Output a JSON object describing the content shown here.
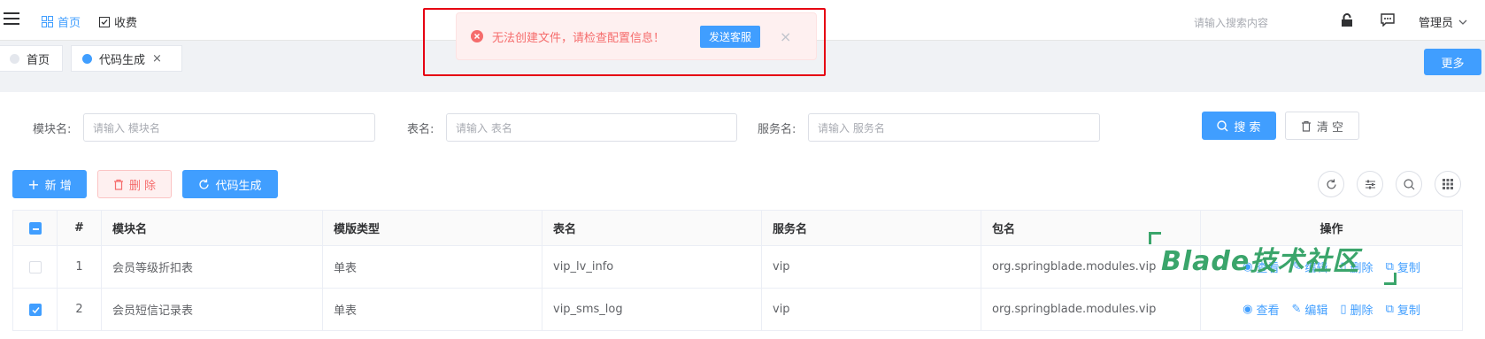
{
  "topbar": {
    "nav": [
      {
        "label": "首页",
        "icon": "grid-icon"
      },
      {
        "label": "收费",
        "icon": "checkbox-icon"
      }
    ],
    "search_placeholder": "请输入搜索内容",
    "user": "管理员"
  },
  "tags": [
    {
      "label": "首页"
    },
    {
      "label": "代码生成"
    }
  ],
  "more_label": "更多",
  "filters": [
    {
      "label": "模块名:",
      "placeholder": "请输入 模块名"
    },
    {
      "label": "表名:",
      "placeholder": "请输入 表名"
    },
    {
      "label": "服务名:",
      "placeholder": "请输入 服务名"
    }
  ],
  "search_btn": "搜 索",
  "clear_btn": "清 空",
  "toolbar": {
    "add": "新 增",
    "delete": "删 除",
    "generate": "代码生成"
  },
  "table": {
    "headers": [
      "#",
      "模块名",
      "模版类型",
      "表名",
      "服务名",
      "包名",
      "操作"
    ],
    "rows": [
      {
        "index": "1",
        "module": "会员等级折扣表",
        "type": "单表",
        "table": "vip_lv_info",
        "service": "vip",
        "package": "org.springblade.modules.vip",
        "checked": false
      },
      {
        "index": "2",
        "module": "会员短信记录表",
        "type": "单表",
        "table": "vip_sms_log",
        "service": "vip",
        "package": "org.springblade.modules.vip",
        "checked": true
      }
    ],
    "ops": [
      "查看",
      "编辑",
      "删除",
      "复制"
    ]
  },
  "toast": {
    "message": "无法创建文件，请检查配置信息！",
    "button": "发送客服"
  },
  "watermark": "Blade技术社区",
  "colors": {
    "primary": "#409eff",
    "danger": "#f56c6c",
    "watermark": "#3aa56b",
    "highlight": "#e60012"
  }
}
